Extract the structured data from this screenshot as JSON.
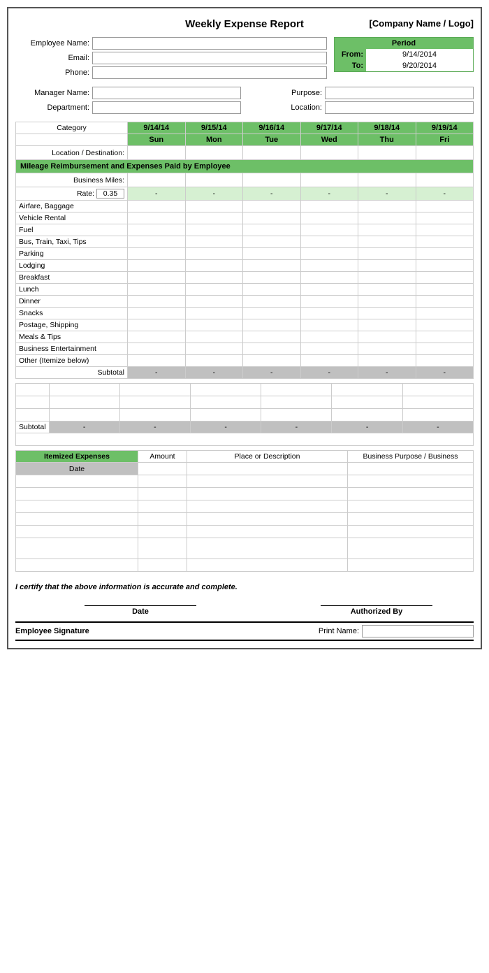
{
  "title": "Weekly Expense Report",
  "company": "[Company Name / Logo]",
  "fields": {
    "employee_name_label": "Employee Name:",
    "email_label": "Email:",
    "phone_label": "Phone:",
    "manager_label": "Manager Name:",
    "department_label": "Department:",
    "purpose_label": "Purpose:",
    "location_label": "Location:"
  },
  "period": {
    "header": "Period",
    "from_label": "From:",
    "from_value": "9/14/2014",
    "to_label": "To:",
    "to_value": "9/20/2014"
  },
  "table": {
    "category_label": "Category",
    "dates": [
      "9/14/14",
      "9/15/14",
      "9/16/14",
      "9/17/14",
      "9/18/14",
      "9/19/14"
    ],
    "days": [
      "Sun",
      "Mon",
      "Tue",
      "Wed",
      "Thu",
      "Fri"
    ],
    "location_row": "Location / Destination:",
    "mileage_section": "Mileage Reimbursement and Expenses Paid by Employee",
    "business_miles_label": "Business Miles:",
    "rate_label": "Rate:",
    "rate_value": "0.35",
    "dash": "-",
    "categories": [
      "Airfare, Baggage",
      "Vehicle Rental",
      "Fuel",
      "Bus, Train, Taxi, Tips",
      "Parking",
      "Lodging",
      "Breakfast",
      "Lunch",
      "Dinner",
      "Snacks",
      "Postage, Shipping",
      "Meals & Tips",
      "Business Entertainment",
      "Other (Itemize below)"
    ],
    "subtotal_label": "Subtotal"
  },
  "itemized": {
    "header": "Itemized Expenses",
    "amount_col": "Amount",
    "place_col": "Place or Description",
    "purpose_col": "Business Purpose / Business",
    "date_col": "Date"
  },
  "certification": "I certify that the above information is accurate and complete.",
  "signatures": {
    "date_label": "Date",
    "authorized_label": "Authorized By",
    "employee_sig_label": "Employee Signature",
    "print_name_label": "Print Name:"
  }
}
